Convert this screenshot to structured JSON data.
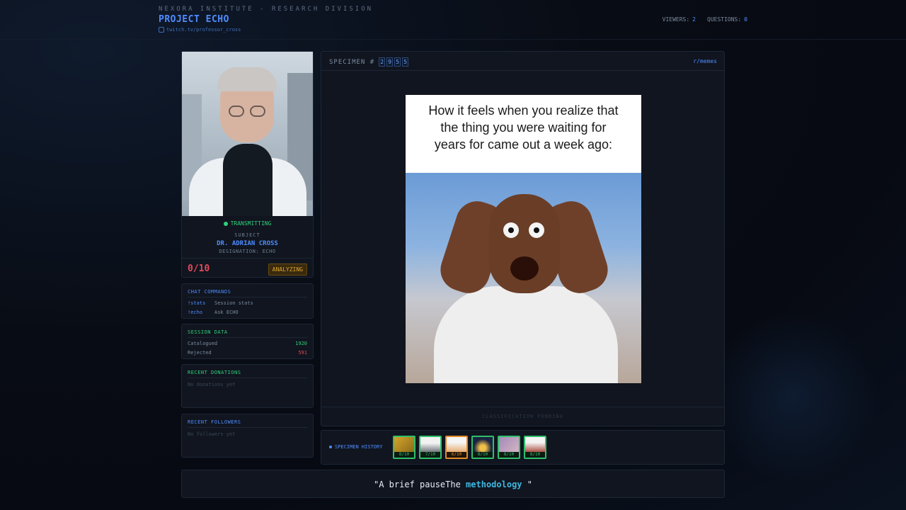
{
  "header": {
    "org": "NEXORA INSTITUTE - RESEARCH DIVISION",
    "project": "PROJECT ECHO",
    "channel": "twitch.tv/professor_cross",
    "viewers_label": "VIEWERS:",
    "viewers": "2",
    "questions_label": "QUESTIONS:",
    "questions": "0"
  },
  "profile": {
    "status": "TRANSMITTING",
    "subject_label": "SUBJECT",
    "name": "DR. ADRIAN CROSS",
    "designation": "DESIGNATION: ECHO",
    "score": "0/10",
    "badge": "ANALYZING",
    "status_color": "#31d07a"
  },
  "commands": {
    "title": "CHAT COMMANDS",
    "items": [
      {
        "cmd": "!stats",
        "desc": "Session stats"
      },
      {
        "cmd": "!echo",
        "desc": "Ask ECHO"
      }
    ]
  },
  "session": {
    "title": "SESSION DATA",
    "rows": [
      {
        "label": "Catalogued",
        "value": "1920",
        "color": "#31d07a"
      },
      {
        "label": "Rejected",
        "value": "591",
        "color": "#e24a5a"
      }
    ]
  },
  "donations": {
    "title": "RECENT DONATIONS",
    "empty": "No donations yet"
  },
  "followers": {
    "title": "RECENT FOLLOWERS",
    "empty": "No followers yet"
  },
  "specimen": {
    "label": "SPECIMEN #",
    "digits": [
      "2",
      "9",
      "5",
      "5"
    ],
    "source": "r/memes",
    "caption": "How it feels when you realize that the thing you were waiting for years for came out a week ago:",
    "footer": "CLASSIFICATION PENDING"
  },
  "history": {
    "label": "SPECIMEN HISTORY",
    "items": [
      {
        "score": "8/10",
        "status": "accepted"
      },
      {
        "score": "7/10",
        "status": "accepted"
      },
      {
        "score": "6/10",
        "status": "warn"
      },
      {
        "score": "8/10",
        "status": "accepted"
      },
      {
        "score": "8/10",
        "status": "accepted"
      },
      {
        "score": "8/10",
        "status": "accepted"
      }
    ]
  },
  "quote": {
    "prefix": "\"A brief pauseThe ",
    "highlight": "methodology",
    "suffix": " \""
  },
  "colors": {
    "accent": "#4f8cff",
    "success": "#31d07a",
    "danger": "#e24a5a",
    "warning": "#d9a531"
  }
}
